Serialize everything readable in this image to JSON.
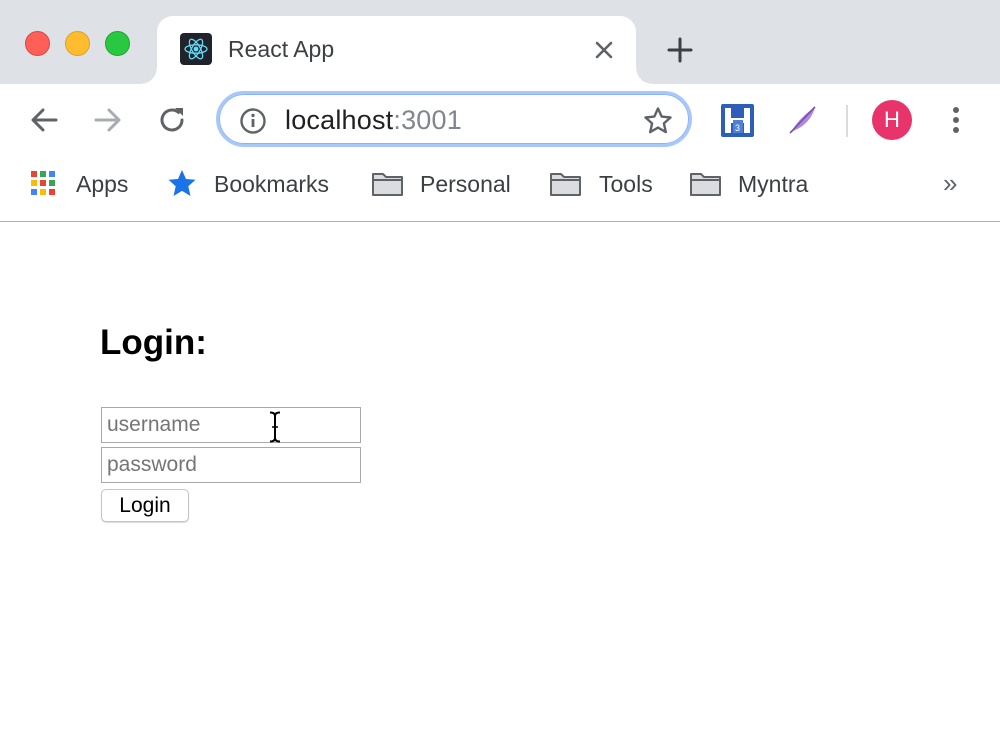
{
  "window": {
    "tab": {
      "title": "React App",
      "favicon": "react-logo-icon"
    },
    "controls": [
      "close-window",
      "minimize-window",
      "maximize-window"
    ],
    "colors": {
      "tl_close": "#fe5f57",
      "tl_min": "#febc2e",
      "tl_max": "#28c840"
    }
  },
  "toolbar": {
    "url_host": "localhost",
    "url_port": ":3001",
    "icons": [
      "back-icon",
      "forward-icon",
      "reload-icon",
      "info-icon",
      "star-icon",
      "menu-icon"
    ],
    "profile_initial": "H",
    "profile_color": "#e8336b"
  },
  "bookmarks": {
    "items": [
      {
        "label": "Apps",
        "icon": "apps-grid-icon"
      },
      {
        "label": "Bookmarks",
        "icon": "star-icon"
      },
      {
        "label": "Personal",
        "icon": "folder-icon"
      },
      {
        "label": "Tools",
        "icon": "folder-icon"
      },
      {
        "label": "Myntra",
        "icon": "folder-icon"
      }
    ],
    "overflow": "»"
  },
  "page": {
    "heading": "Login:",
    "username_placeholder": "username",
    "password_placeholder": "password",
    "login_button": "Login"
  }
}
